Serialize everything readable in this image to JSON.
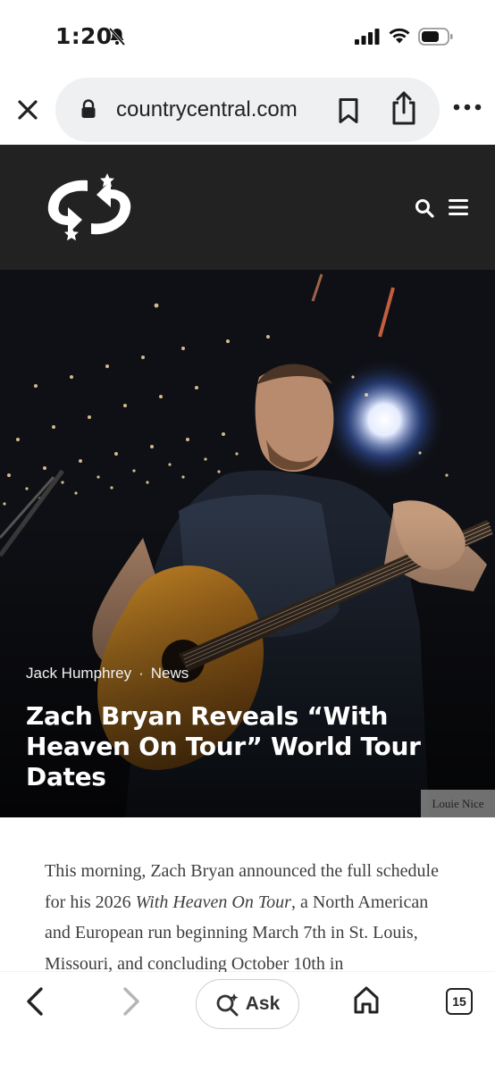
{
  "status_bar": {
    "time": "1:20",
    "icons": [
      "bell-slash-icon",
      "cellular-signal-icon",
      "wifi-icon",
      "battery-icon"
    ]
  },
  "browser": {
    "url": "countrycentral.com",
    "icons": [
      "close-icon",
      "lock-icon",
      "bookmark-icon",
      "share-icon",
      "more-icon"
    ]
  },
  "site_header": {
    "icons": [
      "site-logo-icon",
      "search-icon",
      "hamburger-menu-icon"
    ],
    "background": "#222223"
  },
  "hero": {
    "author": "Jack Humphrey",
    "separator": "·",
    "category": "News",
    "title": "Zach Bryan Reveals “With Heaven On Tour” World Tour Dates",
    "photo_credit": "Louie Nice"
  },
  "article": {
    "p1_a": "This morning, Zach Bryan announced the full schedule for his 2026 ",
    "p1_em": "With Heaven On Tour",
    "p1_b": ", a North American and European run beginning March 7th in St. Louis, Missouri, and concluding October 10th in"
  },
  "bottom_toolbar": {
    "ask_label": "Ask",
    "tab_count": "15",
    "icons": [
      "back-chevron-icon",
      "forward-chevron-icon",
      "sparkle-search-icon",
      "home-icon",
      "tabs-icon"
    ]
  }
}
